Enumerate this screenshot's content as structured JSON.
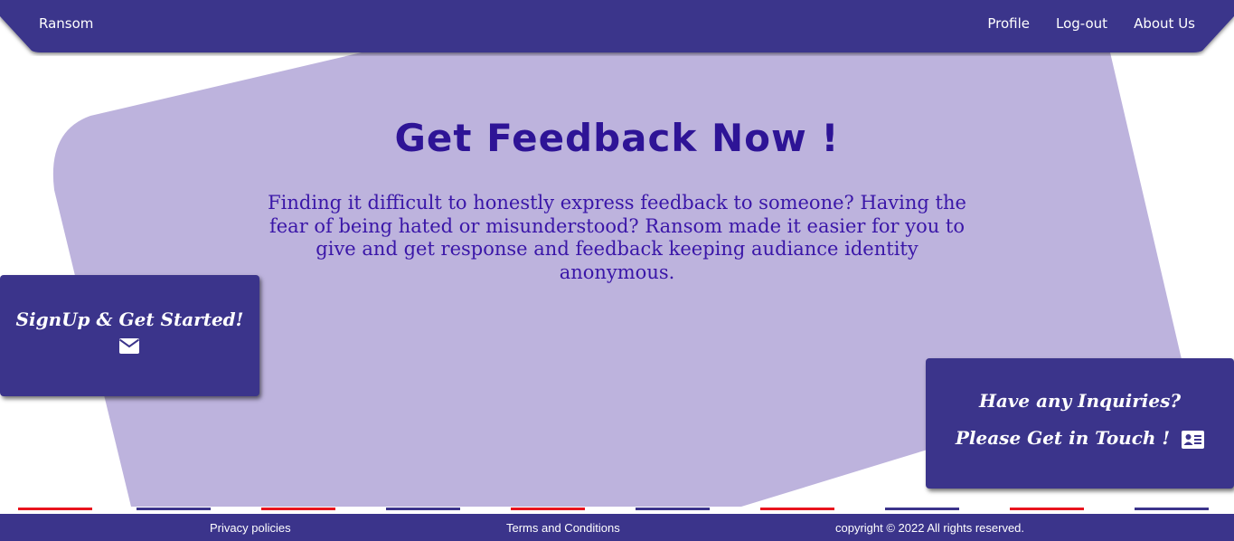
{
  "colors": {
    "primary": "#3b348b",
    "blob": "#bdb3dd",
    "heading": "#2e1496",
    "body_text": "#3a16a8",
    "stripe_red": "#e8141e",
    "stripe_blue": "#3b348b"
  },
  "navbar": {
    "brand": "Ransom",
    "links": [
      "Profile",
      "Log-out",
      "About Us"
    ]
  },
  "hero": {
    "title": "Get Feedback Now !",
    "text": "Finding it difficult to honestly express feedback to someone? Having the fear of being hated or misunderstood? Ransom made it easier for you to give and get response and feedback keeping audiance identity anonymous."
  },
  "signup": {
    "label": "SignUp & Get Started!",
    "icon": "envelope-icon"
  },
  "contact": {
    "line1": "Have any Inquiries?",
    "line2": "Please Get in Touch !",
    "icon": "contact-card-icon"
  },
  "footer": {
    "privacy": "Privacy policies",
    "terms": "Terms and Conditions",
    "copyright": "copyright © 2022 All rights reserved."
  }
}
